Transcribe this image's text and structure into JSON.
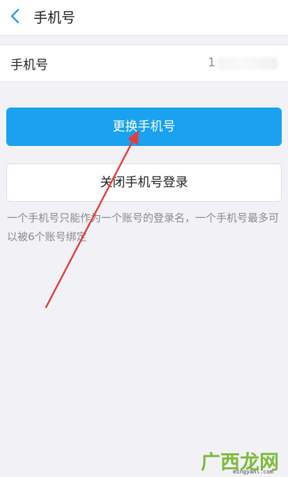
{
  "header": {
    "title": "手机号",
    "back_icon": "chevron-left-icon"
  },
  "phone_row": {
    "label": "手机号",
    "value_visible": "1"
  },
  "buttons": {
    "change_phone": "更换手机号",
    "disable_phone_login": "关闭手机号登录"
  },
  "note": "一个手机号只能作为一个账号的登录名，一个手机号最多可以被6个账号绑定",
  "watermark": {
    "cn": "广西龙网",
    "url": "mingyanl.com"
  },
  "colors": {
    "accent": "#1aa1f0",
    "arrow": "#e0403a",
    "background": "#f2f2f6"
  }
}
